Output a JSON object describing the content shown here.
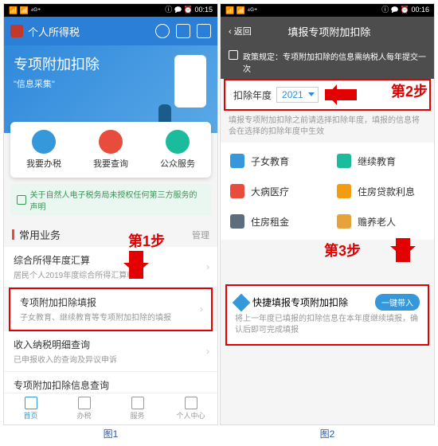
{
  "status": {
    "left": "📶 📶 ⁴ᴳ⁺",
    "right": "ⓘ 🗭 ⏰ ",
    "time1": "00:15",
    "time2": "00:16"
  },
  "p1": {
    "title": "个人所得税",
    "banner": {
      "title": "专项附加扣除",
      "sub": "\"信息采集\""
    },
    "actions": [
      "我要办税",
      "我要查询",
      "公众服务"
    ],
    "notice": "关于自然人电子税务局未授权任何第三方服务的声明",
    "section": "常用业务",
    "mgmt": "管理",
    "items": [
      {
        "t": "综合所得年度汇算",
        "s": "居民个人2019年度综合所得汇算申报"
      },
      {
        "t": "专项附加扣除填报",
        "s": "子女教育、继续教育等专项附加扣除的填报"
      },
      {
        "t": "收入纳税明细查询",
        "s": "已申报收入的查询及异议申诉"
      },
      {
        "t": "专项附加扣除信息查询",
        "s": ""
      }
    ],
    "tabs": [
      "首页",
      "办税",
      "服务",
      "个人中心"
    ],
    "step1": "第1步",
    "caption": "图1"
  },
  "p2": {
    "back": "返回",
    "title": "填报专项附加扣除",
    "policy": "政策规定：专项附加扣除的信息需纳税人每年提交一次",
    "yearlbl": "扣除年度",
    "year": "2021",
    "hint": "填报专项附加扣除之前请选择扣除年度，填报的信息将会在选择的扣除年度中生效",
    "grid": [
      "子女教育",
      "继续教育",
      "大病医疗",
      "住房贷款利息",
      "住房租金",
      "赡养老人"
    ],
    "quick": {
      "t": "快捷填报专项附加扣除",
      "btn": "一键带入",
      "s": "将上一年度已填报的扣除信息在本年度继续填报，确认后即可完成填报"
    },
    "step2": "第2步",
    "step3": "第3步",
    "caption": "图2"
  }
}
